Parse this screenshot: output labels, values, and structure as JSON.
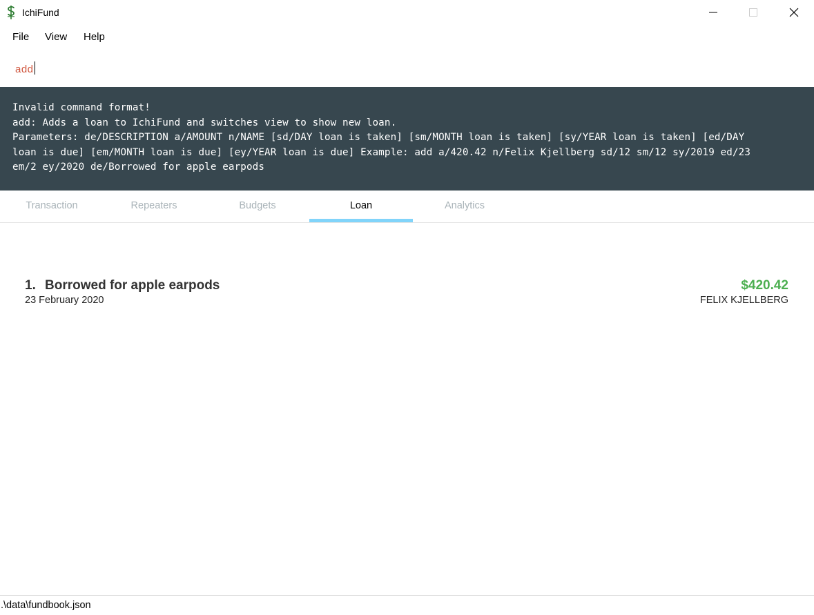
{
  "window": {
    "title": "IchiFund",
    "app_icon": "dollar-caduceus-icon",
    "controls": [
      "minimize-icon",
      "maximize-icon",
      "close-icon"
    ]
  },
  "menu": {
    "file": "File",
    "view": "View",
    "help": "Help"
  },
  "command": {
    "value": "add"
  },
  "result": {
    "lines": [
      "Invalid command format!",
      "add: Adds a loan to IchiFund and switches view to show new loan.",
      "Parameters: de/DESCRIPTION a/AMOUNT n/NAME [sd/DAY loan is taken] [sm/MONTH loan is taken] [sy/YEAR loan is taken] [ed/DAY",
      "loan is due] [em/MONTH loan is due] [ey/YEAR loan is due] Example: add a/420.42 n/Felix Kjellberg sd/12 sm/12 sy/2019 ed/23",
      "em/2 ey/2020 de/Borrowed for apple earpods"
    ]
  },
  "tabs": [
    {
      "label": "Transaction",
      "active": false
    },
    {
      "label": "Repeaters",
      "active": false
    },
    {
      "label": "Budgets",
      "active": false
    },
    {
      "label": "Loan",
      "active": true
    },
    {
      "label": "Analytics",
      "active": false
    }
  ],
  "loans": [
    {
      "index": "1.",
      "description": "Borrowed for apple earpods",
      "date": "23 February 2020",
      "amount": "$420.42",
      "name": "FELIX KJELLBERG"
    }
  ],
  "status": {
    "path": ".\\data\\fundbook.json"
  },
  "colors": {
    "result_bg": "#37474f",
    "tab_indicator": "#81d4fa",
    "amount": "#4caf50",
    "command_text": "#d0573f"
  }
}
